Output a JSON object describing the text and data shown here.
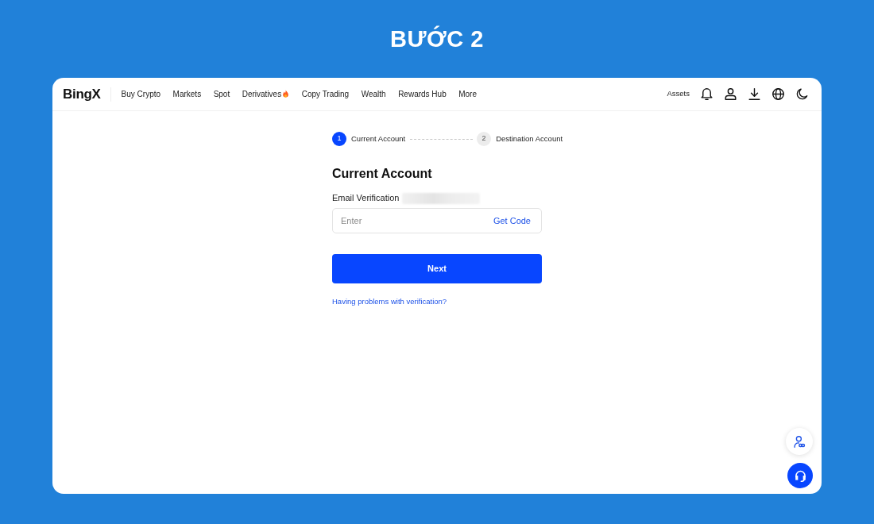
{
  "page_title": "BƯỚC 2",
  "navbar": {
    "logo": "BingX",
    "items": [
      {
        "label": "Buy Crypto",
        "hot": false
      },
      {
        "label": "Markets",
        "hot": false
      },
      {
        "label": "Spot",
        "hot": false
      },
      {
        "label": "Derivatives",
        "hot": true
      },
      {
        "label": "Copy Trading",
        "hot": false
      },
      {
        "label": "Wealth",
        "hot": false
      },
      {
        "label": "Rewards Hub",
        "hot": false
      },
      {
        "label": "More",
        "hot": false
      }
    ],
    "assets": "Assets"
  },
  "stepper": [
    {
      "number": "1",
      "label": "Current Account",
      "selected": true
    },
    {
      "number": "2",
      "label": "Destination Account",
      "selected": false
    }
  ],
  "form": {
    "title": "Current Account",
    "field_label": "Email Verification",
    "code_input": {
      "placeholder": "Enter"
    },
    "get_code": "Get Code",
    "submit": "Next",
    "help_link": "Having problems with verification?"
  }
}
